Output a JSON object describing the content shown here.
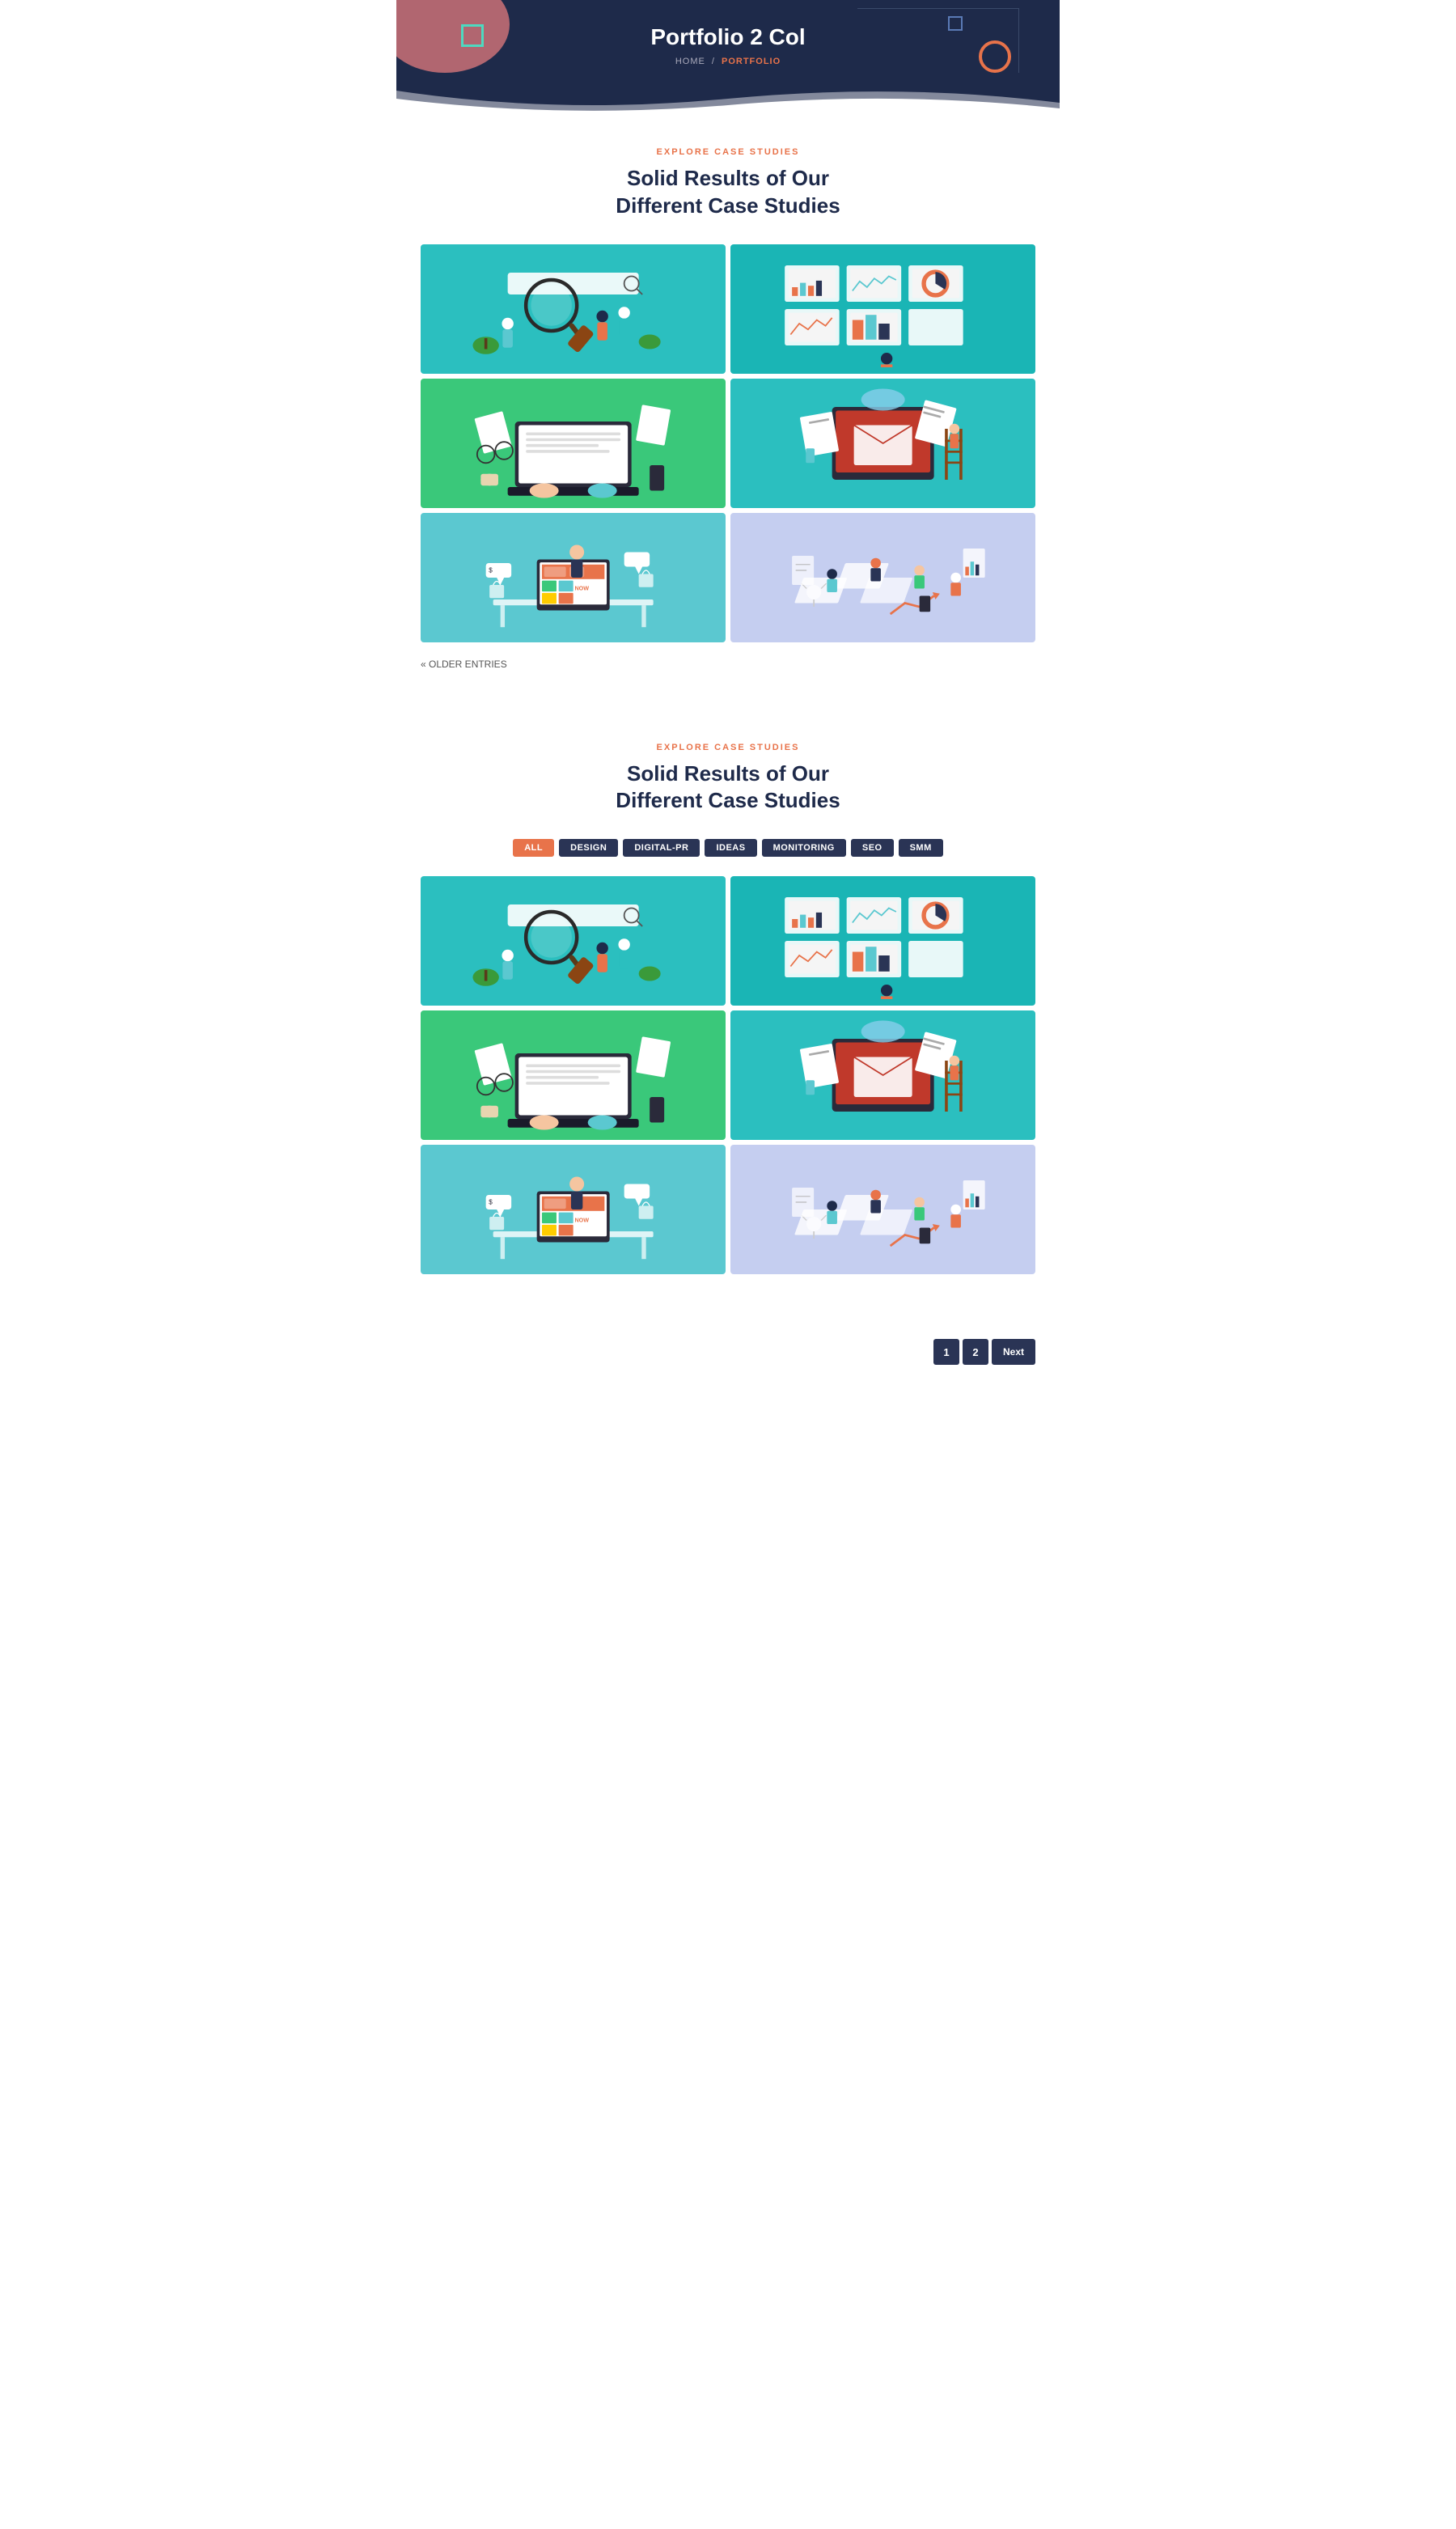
{
  "header": {
    "title": "Portfolio 2 Col",
    "breadcrumb": {
      "home": "HOME",
      "separator": "/",
      "current": "PORTFOLIO"
    }
  },
  "section1": {
    "label": "EXPLORE CASE STUDIES",
    "title_line1": "Solid Results of Our",
    "title_line2": "Different Case Studies",
    "older_entries": "« OLDER ENTRIES"
  },
  "section2": {
    "label": "EXPLORE CASE STUDIES",
    "title_line1": "Solid Results of Our",
    "title_line2": "Different Case Studies",
    "filters": [
      {
        "label": "ALL",
        "active": true
      },
      {
        "label": "DESIGN",
        "active": false
      },
      {
        "label": "DIGITAL-PR",
        "active": false
      },
      {
        "label": "IDEAS",
        "active": false
      },
      {
        "label": "MONITORING",
        "active": false
      },
      {
        "label": "SEO",
        "active": false
      },
      {
        "label": "SMM",
        "active": false
      }
    ]
  },
  "pagination": {
    "pages": [
      "1",
      "2"
    ],
    "next_label": "Next"
  },
  "portfolio_items": [
    {
      "id": 1,
      "color": "teal",
      "theme": "search"
    },
    {
      "id": 2,
      "color": "teal2",
      "theme": "analytics"
    },
    {
      "id": 3,
      "color": "green",
      "theme": "laptop"
    },
    {
      "id": 4,
      "color": "teal",
      "theme": "email"
    },
    {
      "id": 5,
      "color": "blue",
      "theme": "shop"
    },
    {
      "id": 6,
      "color": "lavender",
      "theme": "office"
    }
  ]
}
